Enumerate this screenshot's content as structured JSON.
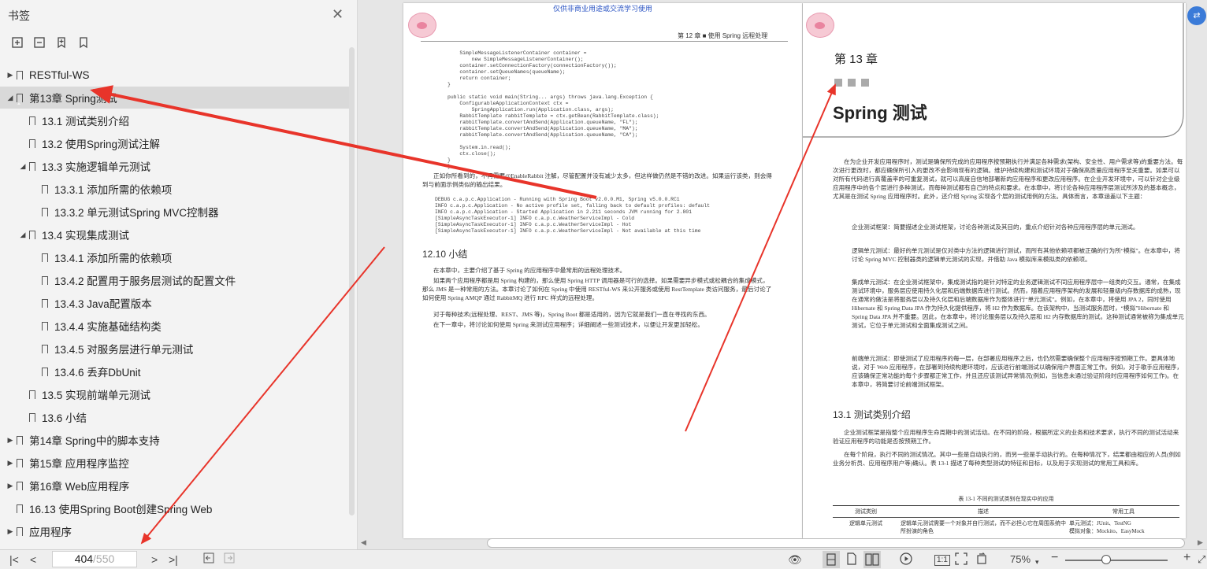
{
  "sidebar": {
    "title": "书签",
    "items": [
      {
        "label": "RESTful-WS",
        "level": 0,
        "caret": "▶"
      },
      {
        "label": "第13章 Spring测试",
        "level": 0,
        "caret": "◢",
        "selected": true
      },
      {
        "label": "13.1 测试类别介绍",
        "level": 1,
        "caret": ""
      },
      {
        "label": "13.2 使用Spring测试注解",
        "level": 1,
        "caret": ""
      },
      {
        "label": "13.3 实施逻辑单元测试",
        "level": 1,
        "caret": "◢"
      },
      {
        "label": "13.3.1 添加所需的依赖项",
        "level": 2,
        "caret": ""
      },
      {
        "label": "13.3.2 单元测试Spring MVC控制器",
        "level": 2,
        "caret": ""
      },
      {
        "label": "13.4 实现集成测试",
        "level": 1,
        "caret": "◢"
      },
      {
        "label": "13.4.1 添加所需的依赖项",
        "level": 2,
        "caret": ""
      },
      {
        "label": "13.4.2 配置用于服务层测试的配置文件",
        "level": 2,
        "caret": ""
      },
      {
        "label": "13.4.3 Java配置版本",
        "level": 2,
        "caret": ""
      },
      {
        "label": "13.4.4 实施基础结构类",
        "level": 2,
        "caret": ""
      },
      {
        "label": "13.4.5 对服务层进行单元测试",
        "level": 2,
        "caret": ""
      },
      {
        "label": "13.4.6 丢弃DbUnit",
        "level": 2,
        "caret": ""
      },
      {
        "label": "13.5 实现前端单元测试",
        "level": 1,
        "caret": ""
      },
      {
        "label": "13.6 小结",
        "level": 1,
        "caret": ""
      },
      {
        "label": "第14章 Spring中的脚本支持",
        "level": 0,
        "caret": "▶"
      },
      {
        "label": "第15章 应用程序监控",
        "level": 0,
        "caret": "▶"
      },
      {
        "label": "第16章 Web应用程序",
        "level": 0,
        "caret": "▶"
      },
      {
        "label": "16.13 使用Spring Boot创建Spring Web",
        "level": 0,
        "caret": ""
      },
      {
        "label": "应用程序",
        "level": 0,
        "caret": "▶"
      }
    ]
  },
  "left_page": {
    "watermark": "仅供非商业用途或交流学习使用",
    "header": "第 12 章 ■ 使用 Spring 远程处理",
    "code1": "    SimpleMessageListenerContainer container =\n        new SimpleMessageListenerContainer();\n    container.setConnectionFactory(connectionFactory());\n    container.setQueueNames(queueName);\n    return container;\n}\n\npublic static void main(String... args) throws java.lang.Exception {\n    ConfigurableApplicationContext ctx =\n        SpringApplication.run(Application.class, args);\n    RabbitTemplate rabbitTemplate = ctx.getBean(RabbitTemplate.class);\n    rabbitTemplate.convertAndSend(Application.queueName, \"FL\");\n    rabbitTemplate.convertAndSend(Application.queueName, \"MA\");\n    rabbitTemplate.convertAndSend(Application.queueName, \"CA\");\n\n    System.in.read();\n    ctx.close();\n}\n}",
    "para1": "正如你所看到的，不再需要@EnableRabbit 注解，尽管配置并没有减少太多，但这样做仍然是不错的改进。如果运行该类，则会得到与前面示例类似的输出结果。",
    "code2": "DEBUG c.a.p.c.Application - Running with Spring Boot v2.0.0.M1, Spring v5.0.0.RC1\nINFO c.a.p.c.Application - No active profile set, falling back to default profiles: default\nINFO c.a.p.c.Application - Started Application in 2.211 seconds JVM running for 2.801\n[SimpleAsyncTaskExecutor-1] INFO c.a.p.c.WeatherServiceImpl - Cold\n[SimpleAsyncTaskExecutor-1] INFO c.a.p.c.WeatherServiceImpl - Hot\n[SimpleAsyncTaskExecutor-1] INFO c.a.p.c.WeatherServiceImpl - Not available at this time",
    "section": "12.10  小结",
    "para2": "在本章中，主要介绍了基于 Spring 的应用程序中最常用的远程处理技术。",
    "para3": "如果两个应用程序都是用 Spring 构建的，那么使用 Spring HTTP 调用器是可行的选择。如果需要异步模式或松耦合的集成模式，那么 JMS 是一种常用的方法。本章讨论了如何在 Spring 中使用 RESTful-WS 来公开服务或使用 RestTemplate 类访问服务，最后讨论了如何使用 Spring AMQP 通过 RabbitMQ 进行 RPC 样式的远程处理。",
    "para4": "对于每种技术(远程处理、REST、JMS 等)，Spring Boot 都是适用的，因为它就是我们一直在寻找的东西。",
    "para5": "在下一章中，将讨论如何使用 Spring 来测试应用程序；详细阐述一些测试技术，以便让开发更加轻松。"
  },
  "right_page": {
    "chapter_num": "第 13 章",
    "chapter_title": "Spring 测试",
    "intro": "在为企业开发应用程序时，测试是确保所完成的应用程序按预期执行并满足各种需求(架构、安全性、用户需求等)的重要方法。每次进行更改时，都应确保所引入的更改不会影响现有的逻辑。维护持续构建和测试环境对于确保高质量应用程序至关重要。如果可以对所有代码进行高覆盖率的可重复测试，就可以高度自信地部署新的应用程序和更改应用程序。在企业开发环境中，可以针对企业级应用程序中的各个层进行多种测试，而每种测试都有自己的特点和要求。在本章中，将讨论各种应用程序层测试所涉及的基本概念，尤其是在测试 Spring 应用程序时。此外，还介绍 Spring 实现各个层的测试用例的方法。具体而言，本章涵盖以下主题：",
    "b1": "企业测试框架：简要描述企业测试框架，讨论各种测试及其目的，重点介绍针对各种应用程序层的单元测试。",
    "b2": "逻辑单元测试：最好的单元测试是仅对类中方法的逻辑进行测试，而所有其他依赖项都被正确的行为所“模拟”。在本章中，将讨论 Spring MVC 控制器类的逻辑单元测试的实现，并借助 Java 模拟库来模拟类的依赖项。",
    "b3": "集成单元测试：在企业测试框架中，集成测试指的是针对特定的业务逻辑测试不同应用程序层中一组类的交互。通常，在集成测试环境中，服务层应使用持久化层和后端数据库进行测试。然而，随着应用程序架构的发展和轻量级内存数据库的成熟，现在通常的做法是将服务层以及持久化层和后端数据库作为整体进行“单元测试”。例如，在本章中，将使用 JPA 2，同时使用 Hibernate 和 Spring Data JPA 作为持久化提供程序，将 H2 作为数据库。在该架构中，当测试服务层时，“模拟”Hibernate 和 Spring Data JPA 并不重要。因此，在本章中，将讨论服务层以及持久层和 H2 内存数据库的测试。这种测试通常被称为集成单元测试，它位于单元测试和全面集成测试之间。",
    "b4": "前端单元测试：即使测试了应用程序的每一层，在部署应用程序之后，也仍然需要确保整个应用程序按预期工作。更具体地说，对于 Web 应用程序，在部署到持续构建环境时，应该进行前端测试以确保用户界面正常工作。例如，对于歌手应用程序，应该确保正常功能的每个步骤都正常工作，并且还应该测试异常情况(例如，当信息未通过验证阶段时应用程序如何工作)。在本章中，将简要讨论前端测试框架。",
    "section": "13.1  测试类别介绍",
    "s1": "企业测试框架是指整个应用程序生命周期中的测试活动。在不同的阶段，根据所定义的业务和技术要求，执行不同的测试活动来验证应用程序的功能是否按预期工作。",
    "s2": "在每个阶段，执行不同的测试情况。其中一些是自动执行的，而另一些是手动执行的。在每种情况下，结果都由相应的人员(例如业务分析员、应用程序用户等)确认。表 13-1 描述了每种类型测试的特征和目标，以及用于实现测试的常用工具和库。",
    "table_caption": "表 13-1  不同的测试类别在现实中的应用",
    "table_headers": [
      "测试类别",
      "描述",
      "常用工具"
    ],
    "table_row": [
      "逻辑单元测试",
      "逻辑单元测试需要一个对象并自行测试，而不必担心它在周围系统中所扮演的角色",
      "单元测试：JUnit、TestNG\n模拟对象：Mockito、EasyMock"
    ]
  },
  "bottombar": {
    "current_page": "404",
    "total_pages": "/550",
    "zoom": "75%"
  },
  "icons": {
    "close": "close-icon",
    "expand_all": "expand-all-icon",
    "collapse_all": "collapse-all-icon",
    "add_bookmark": "add-bookmark-icon",
    "bookmark": "bookmark-icon"
  },
  "colors": {
    "arrow": "#e8342a",
    "selected_row": "#d9d9d9",
    "translate_button": "#3b7bd8"
  }
}
